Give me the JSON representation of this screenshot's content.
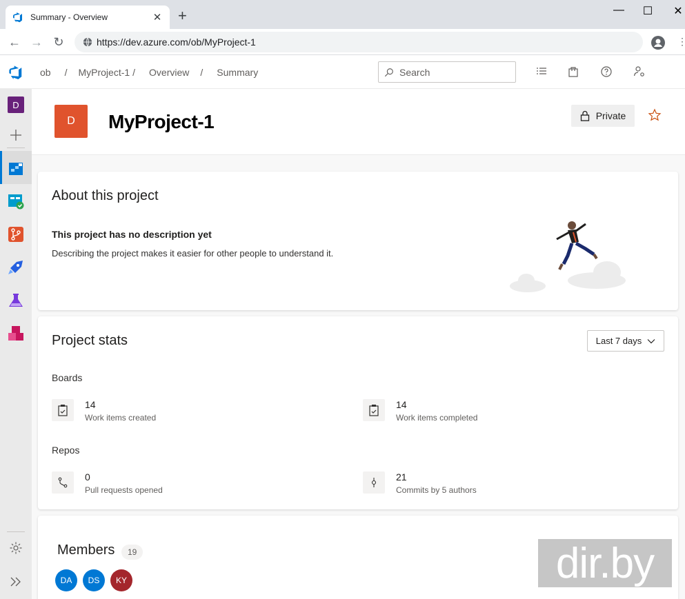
{
  "browser": {
    "tab_title": "Summary - Overview",
    "tab_close": "✕",
    "new_tab": "+",
    "url": "https://dev.azure.com/ob/MyProject-1",
    "window_controls": {
      "minimize": "—",
      "maximize": "☐",
      "close": "✕"
    },
    "nav": {
      "back": "←",
      "forward": "→",
      "reload": "↻"
    },
    "menu": "⋮"
  },
  "topbar": {
    "breadcrumbs": [
      "ob",
      "/",
      "MyProject-1",
      "/",
      "Overview",
      "/",
      "Summary"
    ],
    "search_placeholder": "Search",
    "icons": [
      "task-list-icon",
      "shopping-bag-icon",
      "help-icon",
      "user-settings-icon"
    ]
  },
  "leftnav": {
    "org_initial": "D",
    "org_color": "#68217a",
    "items": [
      "add-icon",
      "overview-icon",
      "boards-icon",
      "repos-icon",
      "pipelines-icon",
      "test-plans-icon",
      "artifacts-icon"
    ],
    "bottom": [
      "settings-icon",
      "expand-icon"
    ]
  },
  "header": {
    "avatar_letter": "D",
    "avatar_color": "#e0532d",
    "project_name": "MyProject-1",
    "visibility": "Private"
  },
  "about": {
    "title": "About this project",
    "subtitle": "This project has no description yet",
    "description": "Describing the project makes it easier for other people to understand it."
  },
  "stats": {
    "title": "Project stats",
    "range": "Last 7 days",
    "boards_label": "Boards",
    "repos_label": "Repos",
    "work_items_created": {
      "value": "14",
      "label": "Work items created"
    },
    "work_items_completed": {
      "value": "14",
      "label": "Work items completed"
    },
    "pull_requests": {
      "value": "0",
      "label": "Pull requests opened"
    },
    "commits": {
      "value": "21",
      "label": "Commits by 5 authors"
    }
  },
  "members": {
    "title": "Members",
    "count": "19",
    "avatars": [
      {
        "initials": "DA",
        "color": "#0078d4"
      },
      {
        "initials": "DS",
        "color": "#0078d4"
      },
      {
        "initials": "KY",
        "color": "#a4262c"
      }
    ]
  },
  "watermark": "dir.by"
}
